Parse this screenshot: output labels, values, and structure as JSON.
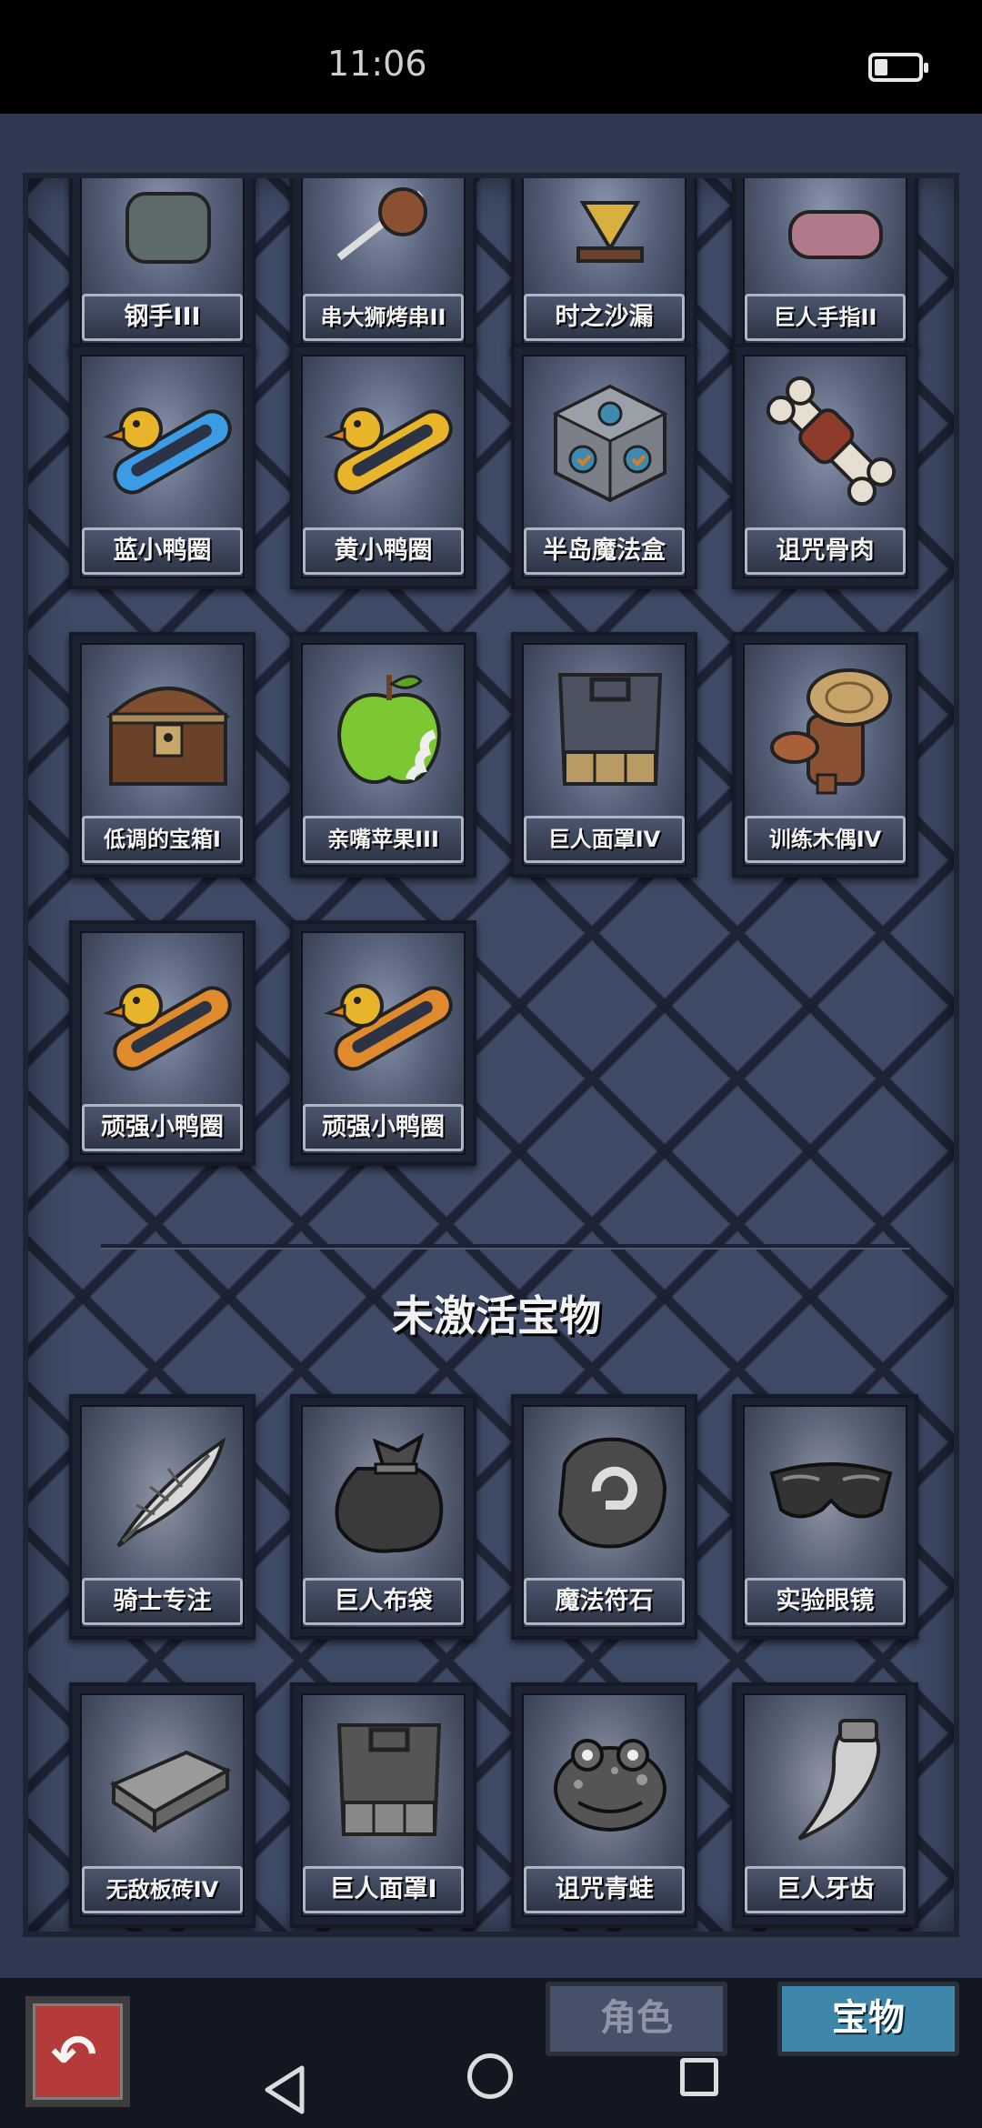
{
  "status_bar": {
    "time": "11:06",
    "battery_level": 0.3
  },
  "active_items": [
    {
      "label": "钢手III",
      "icon": "steel-hand-icon"
    },
    {
      "label": "串大狮烤串II",
      "icon": "kebab-icon"
    },
    {
      "label": "时之沙漏",
      "icon": "hourglass-icon"
    },
    {
      "label": "巨人手指II",
      "icon": "giant-finger-icon"
    },
    {
      "label": "蓝小鸭圈",
      "icon": "blue-duck-ring-icon"
    },
    {
      "label": "黄小鸭圈",
      "icon": "yellow-duck-ring-icon"
    },
    {
      "label": "半岛魔法盒",
      "icon": "magic-cube-icon"
    },
    {
      "label": "诅咒骨肉",
      "icon": "cursed-bone-meat-icon"
    },
    {
      "label": "低调的宝箱I",
      "icon": "treasure-chest-icon"
    },
    {
      "label": "亲嘴苹果III",
      "icon": "green-apple-icon"
    },
    {
      "label": "巨人面罩IV",
      "icon": "giant-mask-icon"
    },
    {
      "label": "训练木偶IV",
      "icon": "training-dummy-icon"
    },
    {
      "label": "顽强小鸭圈",
      "icon": "tough-duck-ring-icon"
    },
    {
      "label": "顽强小鸭圈",
      "icon": "tough-duck-ring-icon"
    }
  ],
  "inactive_section_title": "未激活宝物",
  "inactive_items": [
    {
      "label": "骑士专注",
      "icon": "knight-feather-icon"
    },
    {
      "label": "巨人布袋",
      "icon": "giant-sack-icon"
    },
    {
      "label": "魔法符石",
      "icon": "rune-stone-icon"
    },
    {
      "label": "实验眼镜",
      "icon": "lab-goggles-icon"
    },
    {
      "label": "无敌板砖IV",
      "icon": "brick-icon"
    },
    {
      "label": "巨人面罩I",
      "icon": "giant-mask-icon"
    },
    {
      "label": "诅咒青蛙",
      "icon": "cursed-frog-icon"
    },
    {
      "label": "巨人牙齿",
      "icon": "giant-tooth-icon"
    }
  ],
  "tabs": {
    "role": "角色",
    "treasure": "宝物"
  },
  "colors": {
    "active_tab": "#3e86aa",
    "back_button": "#b53b3b"
  }
}
